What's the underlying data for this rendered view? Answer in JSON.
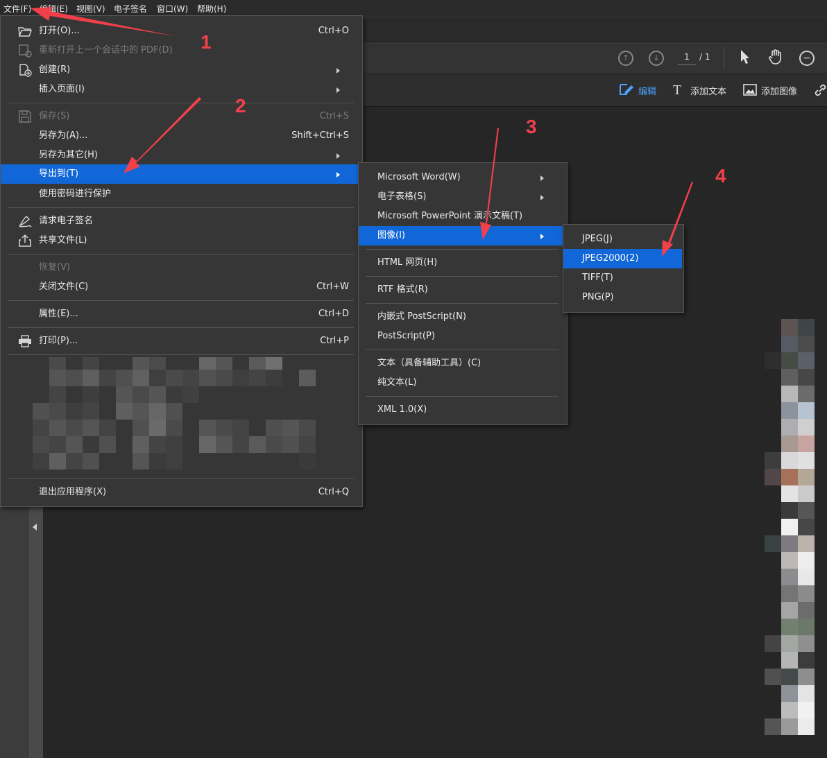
{
  "menubar": {
    "items": [
      "文件(F)",
      "编辑(E)",
      "视图(V)",
      "电子签名",
      "窗口(W)",
      "帮助(H)"
    ]
  },
  "toolbar": {
    "page_current": "1",
    "page_total": "/ 1",
    "edit_label": "编辑",
    "add_text_label": "添加文本",
    "add_image_label": "添加图像"
  },
  "file_menu": {
    "open": {
      "label": "打开(O)...",
      "shortcut": "Ctrl+O"
    },
    "reopen": {
      "label": "重新打开上一个会话中的 PDF(D)"
    },
    "create": {
      "label": "创建(R)"
    },
    "insert_pages": {
      "label": "插入页面(I)"
    },
    "save": {
      "label": "保存(S)",
      "shortcut": "Ctrl+S"
    },
    "save_as": {
      "label": "另存为(A)...",
      "shortcut": "Shift+Ctrl+S"
    },
    "save_as_other": {
      "label": "另存为其它(H)"
    },
    "export_to": {
      "label": "导出到(T)"
    },
    "protect": {
      "label": "使用密码进行保护"
    },
    "request_sign": {
      "label": "请求电子签名"
    },
    "share": {
      "label": "共享文件(L)"
    },
    "revert": {
      "label": "恢复(V)"
    },
    "close": {
      "label": "关闭文件(C)",
      "shortcut": "Ctrl+W"
    },
    "properties": {
      "label": "属性(E)...",
      "shortcut": "Ctrl+D"
    },
    "print": {
      "label": "打印(P)...",
      "shortcut": "Ctrl+P"
    },
    "exit": {
      "label": "退出应用程序(X)",
      "shortcut": "Ctrl+Q"
    }
  },
  "export_menu": {
    "word": "Microsoft Word(W)",
    "spreadsheet": "电子表格(S)",
    "powerpoint": "Microsoft PowerPoint 演示文稿(T)",
    "image": "图像(I)",
    "html": "HTML 网页(H)",
    "rtf": "RTF 格式(R)",
    "eps": "内嵌式 PostScript(N)",
    "ps": "PostScript(P)",
    "accessible_text": "文本（具备辅助工具）(C)",
    "plain_text": "纯文本(L)",
    "xml": "XML 1.0(X)"
  },
  "image_menu": {
    "jpeg": "JPEG(J)",
    "jpeg2000": "JPEG2000(2)",
    "tiff": "TIFF(T)",
    "png": "PNG(P)"
  },
  "annotations": [
    "1",
    "2",
    "3",
    "4"
  ],
  "colors": {
    "highlight": "#1166d8",
    "menu_bg": "#363636",
    "annotation_red": "#f2404b"
  }
}
